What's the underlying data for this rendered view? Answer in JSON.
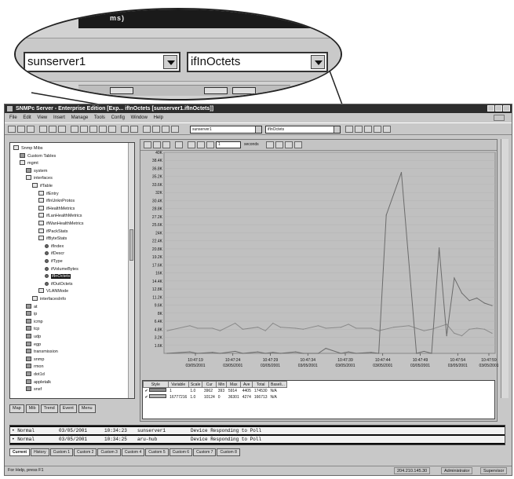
{
  "callout": {
    "top_text": "ms)",
    "agent_value": "sunserver1",
    "variable_value": "ifInOctets"
  },
  "window": {
    "title": "SNMPc Server - Enterprise Edition [Exp... ifInOctets [sunserver1.ifInOctets]]"
  },
  "menu": [
    "File",
    "Edit",
    "View",
    "Insert",
    "Manage",
    "Tools",
    "Config",
    "Window",
    "Help"
  ],
  "toolbar": {
    "agent_value": "sunserver1",
    "variable_value": "ifInOctets"
  },
  "tree": {
    "items": [
      {
        "label": "Snmp Mibs",
        "level": 0,
        "icon": "folder-open"
      },
      {
        "label": "Custom Tables",
        "level": 1,
        "icon": "folder"
      },
      {
        "label": "mgmt",
        "level": 1,
        "icon": "folder-open"
      },
      {
        "label": "system",
        "level": 2,
        "icon": "folder"
      },
      {
        "label": "interfaces",
        "level": 2,
        "icon": "folder-open"
      },
      {
        "label": "ifTable",
        "level": 3,
        "icon": "table"
      },
      {
        "label": "ifEntry",
        "level": 4,
        "icon": "table"
      },
      {
        "label": "ifInUnknProtos",
        "level": 4,
        "icon": "table"
      },
      {
        "label": "ifHealthMetrics",
        "level": 4,
        "icon": "table"
      },
      {
        "label": "ifLanHealthMetrics",
        "level": 4,
        "icon": "table"
      },
      {
        "label": "ifWanHealthMetrics",
        "level": 4,
        "icon": "table"
      },
      {
        "label": "ifPackStats",
        "level": 4,
        "icon": "table"
      },
      {
        "label": "ifByteStats",
        "level": 4,
        "icon": "table"
      },
      {
        "label": "ifIndex",
        "level": 5,
        "icon": "leaf"
      },
      {
        "label": "ifDescr",
        "level": 5,
        "icon": "leaf"
      },
      {
        "label": "ifType",
        "level": 5,
        "icon": "leaf"
      },
      {
        "label": "ifVolumeBytes",
        "level": 5,
        "icon": "leaf"
      },
      {
        "label": "ifInOctets",
        "level": 5,
        "icon": "leaf",
        "selected": true
      },
      {
        "label": "ifOutOctets",
        "level": 5,
        "icon": "leaf"
      },
      {
        "label": "VLANMode",
        "level": 4,
        "icon": "table"
      },
      {
        "label": "interfacesInfo",
        "level": 3,
        "icon": "table"
      },
      {
        "label": "at",
        "level": 2,
        "icon": "folder"
      },
      {
        "label": "ip",
        "level": 2,
        "icon": "folder"
      },
      {
        "label": "icmp",
        "level": 2,
        "icon": "folder"
      },
      {
        "label": "tcp",
        "level": 2,
        "icon": "folder"
      },
      {
        "label": "udp",
        "level": 2,
        "icon": "folder"
      },
      {
        "label": "egp",
        "level": 2,
        "icon": "folder"
      },
      {
        "label": "transmission",
        "level": 2,
        "icon": "folder"
      },
      {
        "label": "snmp",
        "level": 2,
        "icon": "folder"
      },
      {
        "label": "rmon",
        "level": 2,
        "icon": "folder"
      },
      {
        "label": "dot1d",
        "level": 2,
        "icon": "folder"
      },
      {
        "label": "appletalk",
        "level": 2,
        "icon": "folder"
      },
      {
        "label": "snsf",
        "level": 2,
        "icon": "folder"
      }
    ]
  },
  "tree_tabs": [
    "Map",
    "Mib",
    "Trend",
    "Event",
    "Menu"
  ],
  "chart_toolbar": {
    "spin_value": "1",
    "unit_label": "seconds"
  },
  "chart_data": {
    "type": "line",
    "ylim": [
      0,
      40000
    ],
    "y_ticks": [
      "1.6K",
      "3.2K",
      "4.8K",
      "6.4K",
      "8K",
      "9.6K",
      "11.2K",
      "12.8K",
      "14.4K",
      "16K",
      "17.6K",
      "19.2K",
      "20.8K",
      "22.4K",
      "24K",
      "25.6K",
      "27.2K",
      "28.8K",
      "30.4K",
      "32K",
      "33.6K",
      "35.2K",
      "36.8K",
      "38.4K",
      "40K"
    ],
    "x_ticks": [
      {
        "time": "10:47:19",
        "date": "03/05/2001"
      },
      {
        "time": "10:47:24",
        "date": "03/05/2001"
      },
      {
        "time": "10:47:29",
        "date": "03/05/2001"
      },
      {
        "time": "10:47:34",
        "date": "03/05/2001"
      },
      {
        "time": "10:47:39",
        "date": "03/05/2001"
      },
      {
        "time": "10:47:44",
        "date": "03/05/2001"
      },
      {
        "time": "10:47:49",
        "date": "03/05/2001"
      },
      {
        "time": "10:47:54",
        "date": "03/05/2001"
      },
      {
        "time": "10:47:59",
        "date": "03/05/2001"
      }
    ],
    "x_range": [
      0,
      43
    ],
    "series": [
      {
        "name": "1",
        "x": [
          0,
          3,
          4,
          6,
          7,
          9,
          10,
          12,
          13,
          14,
          15,
          17,
          18,
          20,
          21,
          23,
          24,
          25,
          27,
          28,
          30,
          32,
          33,
          34,
          35,
          37,
          38,
          39,
          40,
          41,
          42,
          43
        ],
        "y": [
          4500,
          5500,
          5000,
          5000,
          4500,
          6000,
          4800,
          5200,
          4500,
          6000,
          5200,
          5000,
          4800,
          5500,
          5000,
          5200,
          5800,
          5000,
          5000,
          4500,
          5200,
          5500,
          5000,
          4500,
          4800,
          5800,
          4000,
          3500,
          4800,
          5000,
          4800,
          4000
        ]
      },
      {
        "name": "16777216",
        "x": [
          0,
          3,
          4,
          6,
          7,
          9,
          10,
          12,
          13,
          14,
          15,
          17,
          18,
          20,
          21,
          23,
          24,
          25,
          27,
          28,
          29,
          31,
          33,
          34,
          35,
          36,
          37,
          38,
          39,
          40,
          41,
          42,
          43
        ],
        "y": [
          0,
          300,
          0,
          200,
          0,
          400,
          0,
          300,
          0,
          200,
          0,
          300,
          0,
          0,
          1000,
          0,
          300,
          0,
          200,
          0,
          27500,
          36000,
          0,
          400,
          0,
          21000,
          3500,
          15000,
          12000,
          10500,
          11000,
          10000,
          9500
        ]
      }
    ]
  },
  "table": {
    "headers": [
      "Style",
      "Variable",
      "Scale",
      "Cur",
      "Min",
      "Max",
      "Ave",
      "Total",
      "Baseli..."
    ],
    "rows": [
      {
        "check": "✔",
        "variable": "1",
        "scale": "1.0",
        "cur": "3962",
        "min": "393",
        "max": "5914",
        "ave": "4405",
        "total": "174530",
        "base": "N/A"
      },
      {
        "check": "✔",
        "variable": "16777216",
        "scale": "1.0",
        "cur": "10124",
        "min": "0",
        "max": "36301",
        "ave": "4274",
        "total": "166713",
        "base": "N/A"
      }
    ]
  },
  "log": [
    {
      "severity": "• Normal",
      "date": "03/05/2001",
      "time": "10:34:23",
      "source": "sunserver1",
      "message": "Device Responding to Poll"
    },
    {
      "severity": "• Normal",
      "date": "03/05/2001",
      "time": "10:34:25",
      "source": "aru-hub",
      "message": "Device Responding to Poll"
    }
  ],
  "log_tabs": [
    "Current",
    "History",
    "Custom 1",
    "Custom 2",
    "Custom 3",
    "Custom 4",
    "Custom 5",
    "Custom 6",
    "Custom 7",
    "Custom 8"
  ],
  "status": {
    "help": "For Help, press F1",
    "ip": "204.210.145.30",
    "user": "Administrator",
    "mode": "Supervisor"
  }
}
